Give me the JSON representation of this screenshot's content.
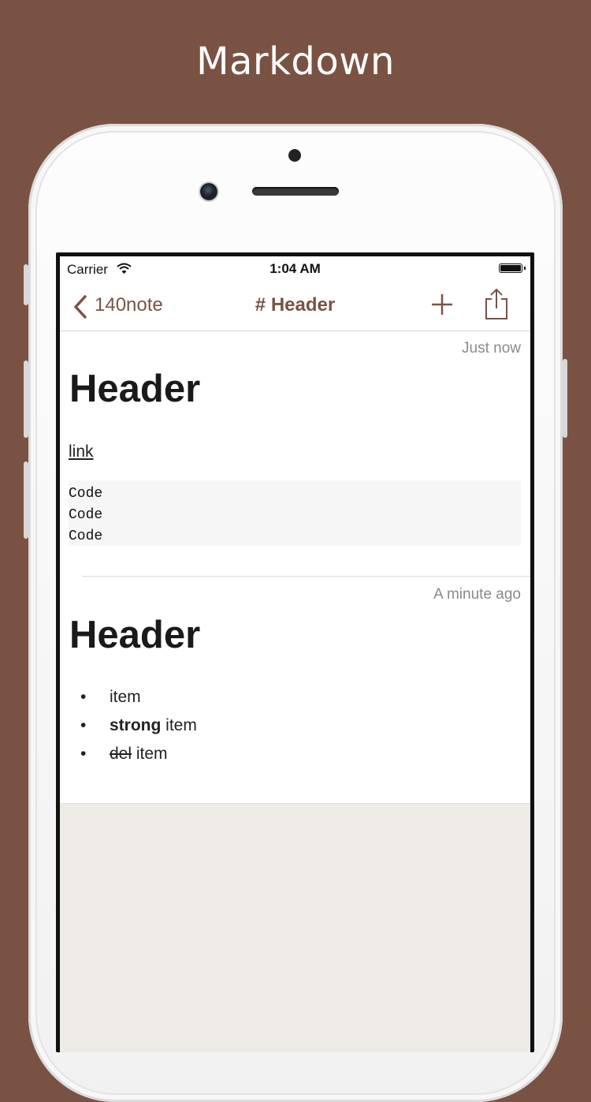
{
  "promo": {
    "title": "Markdown"
  },
  "status_bar": {
    "carrier": "Carrier",
    "time": "1:04 AM"
  },
  "nav": {
    "back_label": "140note",
    "title": "# Header"
  },
  "notes": [
    {
      "timestamp": "Just now",
      "heading": "Header",
      "link": "link",
      "code_lines": [
        "Code",
        "Code",
        "Code"
      ]
    },
    {
      "timestamp": "A minute ago",
      "heading": "Header",
      "list": [
        {
          "bullet": "•",
          "text": "item"
        },
        {
          "bullet": "•",
          "strong": "strong",
          "text": " item"
        },
        {
          "bullet": "•",
          "del": "del",
          "text": " item"
        }
      ]
    }
  ],
  "colors": {
    "brand": "#7a5244",
    "background": "#7a5244",
    "empty_area": "#eeeae6"
  },
  "icons": [
    "wifi-icon",
    "battery-icon",
    "back-chevron-icon",
    "add-icon",
    "share-icon"
  ]
}
